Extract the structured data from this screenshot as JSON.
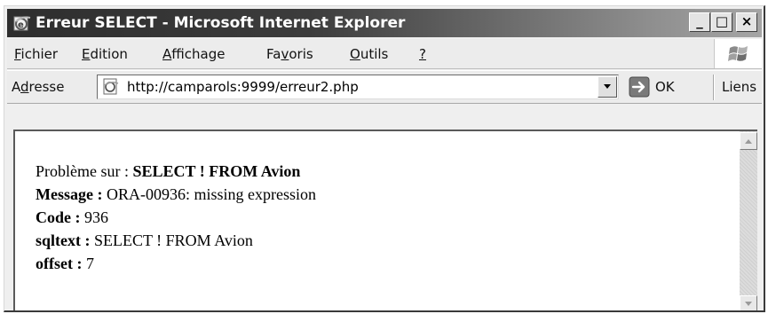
{
  "window": {
    "title": "Erreur SELECT - Microsoft Internet Explorer",
    "minimize_label": "_",
    "maximize_label": "□",
    "close_label": "×"
  },
  "menu": {
    "items": [
      {
        "accel": "F",
        "rest": "ichier"
      },
      {
        "accel": "E",
        "rest": "dition"
      },
      {
        "accel": "A",
        "rest": "ffichage"
      },
      {
        "pre": "Fa",
        "accel": "v",
        "rest": "oris"
      },
      {
        "accel": "O",
        "rest": "utils"
      },
      {
        "accel": "?",
        "rest": ""
      }
    ]
  },
  "address": {
    "label_pre": "A",
    "label_accel": "d",
    "label_rest": "resse",
    "url": "http://camparols:9999/erreur2.php",
    "go_label": "OK",
    "links_label": "Liens"
  },
  "content": {
    "probleme_label": "Problème sur : ",
    "probleme_value": "SELECT ! FROM Avion",
    "message_label": "Message : ",
    "message_value": "ORA-00936: missing expression",
    "code_label": "Code : ",
    "code_value": "936",
    "sqltext_label": "sqltext : ",
    "sqltext_value": "SELECT ! FROM Avion",
    "offset_label": "offset : ",
    "offset_value": "7"
  },
  "icons": {
    "app": "ie-logo-icon",
    "page": "ie-page-icon",
    "dropdown": "chevron-down-icon",
    "go": "arrow-right-icon",
    "throbber": "windows-flag-icon",
    "scroll_up": "arrow-up-icon",
    "scroll_down": "arrow-down-icon"
  }
}
